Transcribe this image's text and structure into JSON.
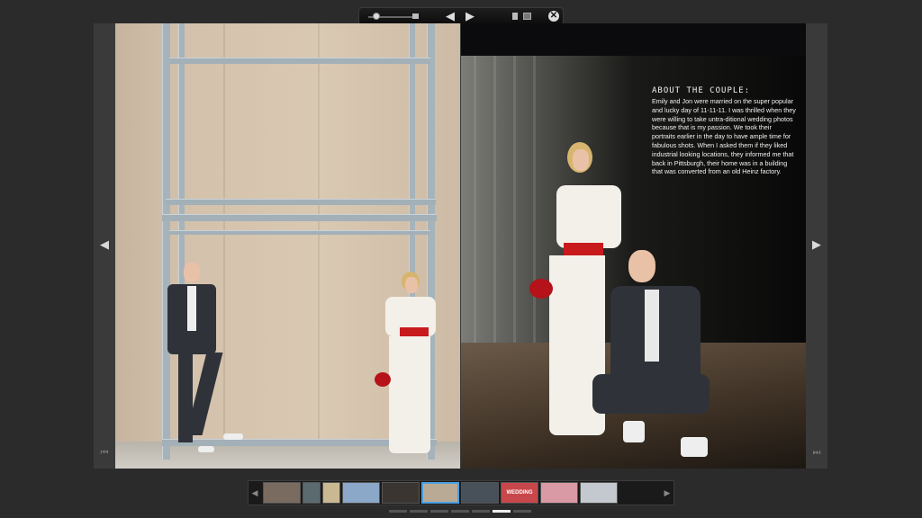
{
  "toolbar": {
    "prev_icon": "◀",
    "next_icon": "▶",
    "close_icon": "✕",
    "zoom_level": 0.1
  },
  "navigation": {
    "left_arrow": "◀",
    "right_arrow": "▶",
    "first_page_icon": "⏮",
    "last_page_icon": "⏭"
  },
  "about": {
    "heading": "ABOUT THE COUPLE:",
    "body": "Emily and Jon were married on the super popular and lucky day of 11-11-11. I was thrilled when they were willing to take untra-ditional wedding photos because that is my passion.   We took their portraits earlier in the day to have ample time for fabulous shots. When I asked them if they liked industrial looking locations, they informed me that back in Pittsburgh, their home was in a building that was converted from an old Heinz factory."
  },
  "thumbnails": [
    {
      "label": "",
      "color": "#7a6b60"
    },
    {
      "label": "",
      "color": "#5b6a6e"
    },
    {
      "label": "",
      "color": "#c9b892"
    },
    {
      "label": "",
      "color": "#8ba8c8"
    },
    {
      "label": "",
      "color": "#3a3530"
    },
    {
      "label": "",
      "color": "#b9aa96"
    },
    {
      "label": "",
      "color": "#48505a"
    },
    {
      "label": "WEDDING CHAPEL",
      "color": "#c8474a"
    },
    {
      "label": "",
      "color": "#d99aa5"
    },
    {
      "label": "",
      "color": "#c3c9cf"
    }
  ],
  "active_thumbnail": 5,
  "page_dots": 7,
  "active_dot": 5,
  "colors": {
    "accent": "#4a9fe0",
    "sash": "#c8191c",
    "background": "#2b2b2b"
  }
}
